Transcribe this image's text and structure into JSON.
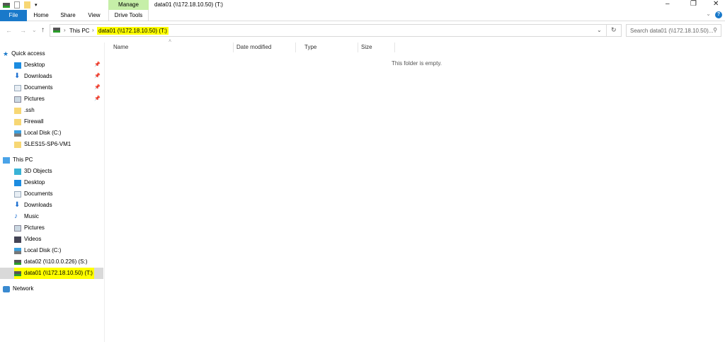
{
  "window": {
    "title": "data01 (\\\\172.18.10.50) (T:)",
    "minimize": "–",
    "restore": "❐",
    "close": "✕",
    "ribbon_toggle": "⌄",
    "help": "?"
  },
  "ribbon": {
    "context_group": "Manage",
    "tabs": [
      "File",
      "Home",
      "Share",
      "View",
      "Drive Tools"
    ]
  },
  "address": {
    "back": "←",
    "forward": "→",
    "recent": "⌄",
    "up": "↑",
    "crumbs": [
      "This PC",
      "data01 (\\\\172.18.10.50) (T:)"
    ],
    "sep": "›",
    "dropdown": "⌄",
    "refresh": "↻"
  },
  "search": {
    "placeholder": "Search data01 (\\\\172.18.10.50)...",
    "icon": "⚲"
  },
  "nav": {
    "quick_access": "Quick access",
    "quick_items": [
      {
        "label": "Desktop",
        "pinned": true
      },
      {
        "label": "Downloads",
        "pinned": true
      },
      {
        "label": "Documents",
        "pinned": true
      },
      {
        "label": "Pictures",
        "pinned": true
      },
      {
        "label": ".ssh"
      },
      {
        "label": "Firewall"
      },
      {
        "label": "Local Disk (C:)"
      },
      {
        "label": "SLES15-SP6-VM1"
      }
    ],
    "this_pc": "This PC",
    "pc_items": [
      "3D Objects",
      "Desktop",
      "Documents",
      "Downloads",
      "Music",
      "Pictures",
      "Videos",
      "Local Disk (C:)",
      "data02 (\\\\10.0.0.226) (S:)",
      "data01 (\\\\172.18.10.50) (T:)"
    ],
    "network": "Network"
  },
  "columns": [
    "Name",
    "Date modified",
    "Type",
    "Size"
  ],
  "empty_message": "This folder is empty."
}
